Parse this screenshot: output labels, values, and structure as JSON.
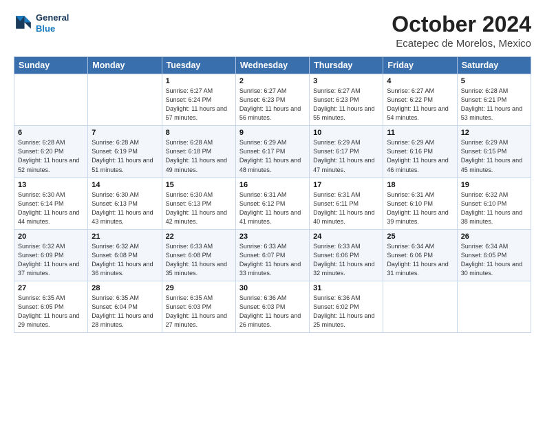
{
  "header": {
    "logo_line1": "General",
    "logo_line2": "Blue",
    "month": "October 2024",
    "location": "Ecatepec de Morelos, Mexico"
  },
  "weekdays": [
    "Sunday",
    "Monday",
    "Tuesday",
    "Wednesday",
    "Thursday",
    "Friday",
    "Saturday"
  ],
  "weeks": [
    [
      {
        "day": "",
        "sunrise": "",
        "sunset": "",
        "daylight": ""
      },
      {
        "day": "",
        "sunrise": "",
        "sunset": "",
        "daylight": ""
      },
      {
        "day": "1",
        "sunrise": "Sunrise: 6:27 AM",
        "sunset": "Sunset: 6:24 PM",
        "daylight": "Daylight: 11 hours and 57 minutes."
      },
      {
        "day": "2",
        "sunrise": "Sunrise: 6:27 AM",
        "sunset": "Sunset: 6:23 PM",
        "daylight": "Daylight: 11 hours and 56 minutes."
      },
      {
        "day": "3",
        "sunrise": "Sunrise: 6:27 AM",
        "sunset": "Sunset: 6:23 PM",
        "daylight": "Daylight: 11 hours and 55 minutes."
      },
      {
        "day": "4",
        "sunrise": "Sunrise: 6:27 AM",
        "sunset": "Sunset: 6:22 PM",
        "daylight": "Daylight: 11 hours and 54 minutes."
      },
      {
        "day": "5",
        "sunrise": "Sunrise: 6:28 AM",
        "sunset": "Sunset: 6:21 PM",
        "daylight": "Daylight: 11 hours and 53 minutes."
      }
    ],
    [
      {
        "day": "6",
        "sunrise": "Sunrise: 6:28 AM",
        "sunset": "Sunset: 6:20 PM",
        "daylight": "Daylight: 11 hours and 52 minutes."
      },
      {
        "day": "7",
        "sunrise": "Sunrise: 6:28 AM",
        "sunset": "Sunset: 6:19 PM",
        "daylight": "Daylight: 11 hours and 51 minutes."
      },
      {
        "day": "8",
        "sunrise": "Sunrise: 6:28 AM",
        "sunset": "Sunset: 6:18 PM",
        "daylight": "Daylight: 11 hours and 49 minutes."
      },
      {
        "day": "9",
        "sunrise": "Sunrise: 6:29 AM",
        "sunset": "Sunset: 6:17 PM",
        "daylight": "Daylight: 11 hours and 48 minutes."
      },
      {
        "day": "10",
        "sunrise": "Sunrise: 6:29 AM",
        "sunset": "Sunset: 6:17 PM",
        "daylight": "Daylight: 11 hours and 47 minutes."
      },
      {
        "day": "11",
        "sunrise": "Sunrise: 6:29 AM",
        "sunset": "Sunset: 6:16 PM",
        "daylight": "Daylight: 11 hours and 46 minutes."
      },
      {
        "day": "12",
        "sunrise": "Sunrise: 6:29 AM",
        "sunset": "Sunset: 6:15 PM",
        "daylight": "Daylight: 11 hours and 45 minutes."
      }
    ],
    [
      {
        "day": "13",
        "sunrise": "Sunrise: 6:30 AM",
        "sunset": "Sunset: 6:14 PM",
        "daylight": "Daylight: 11 hours and 44 minutes."
      },
      {
        "day": "14",
        "sunrise": "Sunrise: 6:30 AM",
        "sunset": "Sunset: 6:13 PM",
        "daylight": "Daylight: 11 hours and 43 minutes."
      },
      {
        "day": "15",
        "sunrise": "Sunrise: 6:30 AM",
        "sunset": "Sunset: 6:13 PM",
        "daylight": "Daylight: 11 hours and 42 minutes."
      },
      {
        "day": "16",
        "sunrise": "Sunrise: 6:31 AM",
        "sunset": "Sunset: 6:12 PM",
        "daylight": "Daylight: 11 hours and 41 minutes."
      },
      {
        "day": "17",
        "sunrise": "Sunrise: 6:31 AM",
        "sunset": "Sunset: 6:11 PM",
        "daylight": "Daylight: 11 hours and 40 minutes."
      },
      {
        "day": "18",
        "sunrise": "Sunrise: 6:31 AM",
        "sunset": "Sunset: 6:10 PM",
        "daylight": "Daylight: 11 hours and 39 minutes."
      },
      {
        "day": "19",
        "sunrise": "Sunrise: 6:32 AM",
        "sunset": "Sunset: 6:10 PM",
        "daylight": "Daylight: 11 hours and 38 minutes."
      }
    ],
    [
      {
        "day": "20",
        "sunrise": "Sunrise: 6:32 AM",
        "sunset": "Sunset: 6:09 PM",
        "daylight": "Daylight: 11 hours and 37 minutes."
      },
      {
        "day": "21",
        "sunrise": "Sunrise: 6:32 AM",
        "sunset": "Sunset: 6:08 PM",
        "daylight": "Daylight: 11 hours and 36 minutes."
      },
      {
        "day": "22",
        "sunrise": "Sunrise: 6:33 AM",
        "sunset": "Sunset: 6:08 PM",
        "daylight": "Daylight: 11 hours and 35 minutes."
      },
      {
        "day": "23",
        "sunrise": "Sunrise: 6:33 AM",
        "sunset": "Sunset: 6:07 PM",
        "daylight": "Daylight: 11 hours and 33 minutes."
      },
      {
        "day": "24",
        "sunrise": "Sunrise: 6:33 AM",
        "sunset": "Sunset: 6:06 PM",
        "daylight": "Daylight: 11 hours and 32 minutes."
      },
      {
        "day": "25",
        "sunrise": "Sunrise: 6:34 AM",
        "sunset": "Sunset: 6:06 PM",
        "daylight": "Daylight: 11 hours and 31 minutes."
      },
      {
        "day": "26",
        "sunrise": "Sunrise: 6:34 AM",
        "sunset": "Sunset: 6:05 PM",
        "daylight": "Daylight: 11 hours and 30 minutes."
      }
    ],
    [
      {
        "day": "27",
        "sunrise": "Sunrise: 6:35 AM",
        "sunset": "Sunset: 6:05 PM",
        "daylight": "Daylight: 11 hours and 29 minutes."
      },
      {
        "day": "28",
        "sunrise": "Sunrise: 6:35 AM",
        "sunset": "Sunset: 6:04 PM",
        "daylight": "Daylight: 11 hours and 28 minutes."
      },
      {
        "day": "29",
        "sunrise": "Sunrise: 6:35 AM",
        "sunset": "Sunset: 6:03 PM",
        "daylight": "Daylight: 11 hours and 27 minutes."
      },
      {
        "day": "30",
        "sunrise": "Sunrise: 6:36 AM",
        "sunset": "Sunset: 6:03 PM",
        "daylight": "Daylight: 11 hours and 26 minutes."
      },
      {
        "day": "31",
        "sunrise": "Sunrise: 6:36 AM",
        "sunset": "Sunset: 6:02 PM",
        "daylight": "Daylight: 11 hours and 25 minutes."
      },
      {
        "day": "",
        "sunrise": "",
        "sunset": "",
        "daylight": ""
      },
      {
        "day": "",
        "sunrise": "",
        "sunset": "",
        "daylight": ""
      }
    ]
  ]
}
